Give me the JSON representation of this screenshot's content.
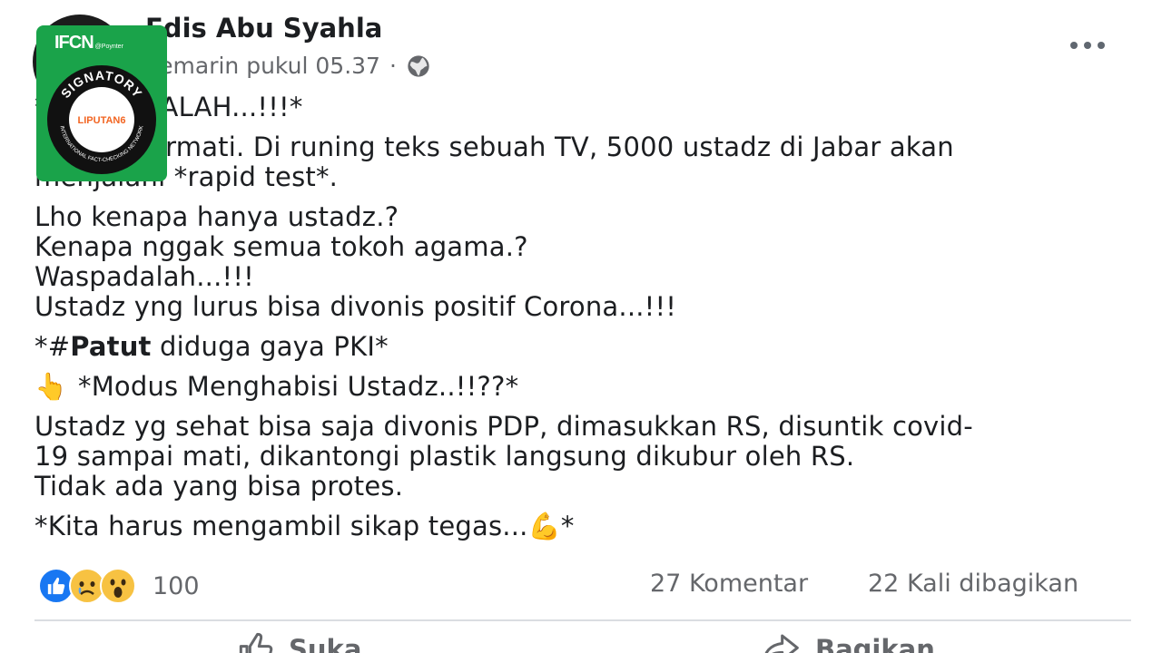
{
  "post": {
    "author": "Edis Abu Syahla",
    "timestamp": "Kemarin pukul 05.37",
    "dot": "·",
    "audience_icon": "globe-icon",
    "body": {
      "p1": "*WASPADALAH...!!!*",
      "p2_l1": "Perlu dicermati. Di runing teks sebuah TV, 5000 ustadz di Jabar akan",
      "p2_l2": "menjalani *rapid test*.",
      "p3_l1": "Lho kenapa hanya ustadz.?",
      "p3_l2": "Kenapa nggak semua tokoh agama.?",
      "p3_l3": "Waspadalah...!!!",
      "p3_l4": "Ustadz yng lurus bisa divonis positif Corona...!!!",
      "p4_prefix": "*#",
      "p4_bold": "Patut",
      "p4_rest": " diduga gaya PKI*",
      "p5_emoji": "👆",
      "p5_text": "*Modus Menghabisi Ustadz..!!??*",
      "p6_l1": "Ustadz yg sehat bisa saja divonis PDP, dimasukkan RS, disuntik covid-",
      "p6_l2": "19 sampai mati, dikantongi plastik langsung dikubur oleh RS.",
      "p6_l3": "Tidak ada yang bisa protes.",
      "p7_text": "*Kita harus mengambil sikap tegas...",
      "p7_emoji": "💪",
      "p7_end": "*"
    }
  },
  "stats": {
    "reactions": [
      "like",
      "sad",
      "wow"
    ],
    "reaction_count": "100",
    "comments": "27 Komentar",
    "shares": "22 Kali dibagikan"
  },
  "actions": {
    "like_label": "Suka",
    "share_label": "Bagikan"
  },
  "badge": {
    "logo": "IFCN",
    "logo_sub": "@Poynter",
    "ring_top": "SIGNATORY",
    "ring_bottom": "INTERNATIONAL FACT-CHECKING NETWORK",
    "center": "LIPUTAN6"
  },
  "colors": {
    "badge_green": "#1aa34a",
    "like_blue": "#1877f2",
    "meta_gray": "#65676b",
    "liputan_orange": "#f26522"
  }
}
